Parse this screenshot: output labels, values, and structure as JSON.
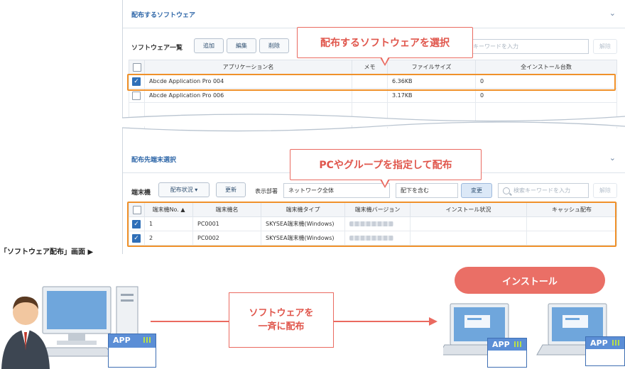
{
  "software_section": {
    "title": "配布するソフトウェア",
    "list_label": "ソフトウェア一覧",
    "add_label": "追加",
    "edit_label": "編集",
    "delete_label": "削除",
    "search_placeholder": "キーワードを入力",
    "clear_label": "解除",
    "columns": [
      "アプリケーション名",
      "メモ",
      "ファイルサイズ",
      "全インストール台数"
    ],
    "rows": [
      {
        "name": "Abcde Application Pro 004",
        "memo": "",
        "size": "6.36KB",
        "count": "0",
        "checked": true
      },
      {
        "name": "Abcde Application Pro 006",
        "memo": "",
        "size": "3.17KB",
        "count": "0",
        "checked": false
      }
    ]
  },
  "target_section": {
    "title": "配布先端末選択",
    "list_label": "端末機",
    "status_label": "配布状況 ▾",
    "refresh_label": "更新",
    "dept_label": "表示部署",
    "dept_value": "ネットワーク全体",
    "sub_value": "配下を含む",
    "change_label": "変更",
    "search_placeholder": "検索キーワードを入力",
    "clear_label": "解除",
    "columns": [
      "端末機No. ▲",
      "端末機名",
      "端末機タイプ",
      "端末機バージョン",
      "インストール状況",
      "キャッシュ配布"
    ],
    "rows": [
      {
        "no": "1",
        "name": "PC0001",
        "type": "SKYSEA端末機(Windows)",
        "checked": true
      },
      {
        "no": "2",
        "name": "PC0002",
        "type": "SKYSEA端末機(Windows)",
        "checked": true
      }
    ]
  },
  "callouts": {
    "select_software": "配布するソフトウェアを選択",
    "assign_targets": "PCやグループを指定して配布"
  },
  "screen_caption": "「ソフトウェア配布」画面 ▶",
  "flow": {
    "message_line1": "ソフトウェアを",
    "message_line2": "一斉に配布",
    "install_label": "インストール",
    "app_label": "APP"
  },
  "colors": {
    "accent": "#ea6a60",
    "highlight": "#f0912a",
    "link": "#2f67a8",
    "check": "#2f6fb8"
  }
}
